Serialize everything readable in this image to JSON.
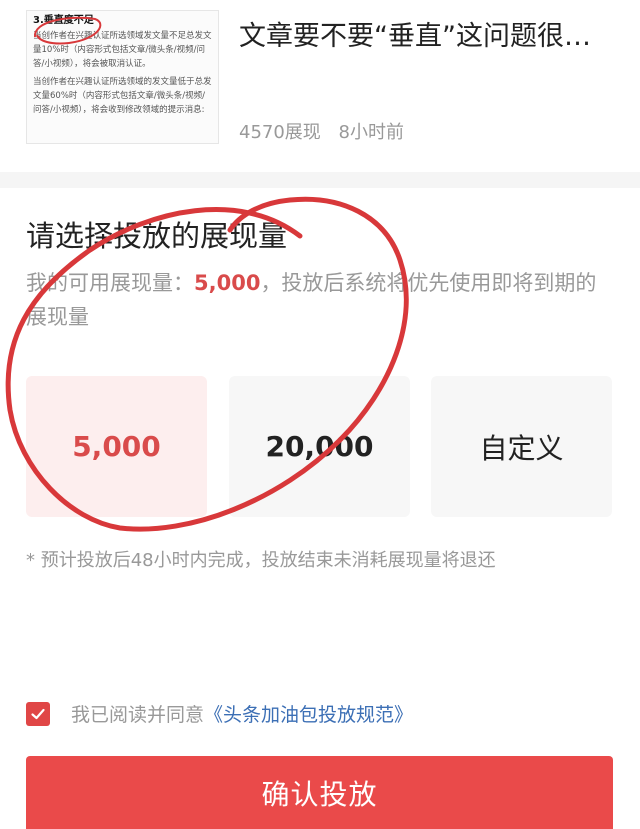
{
  "article": {
    "title": "文章要不要“垂直”这问题很…",
    "views": "4570展现",
    "time": "8小时前",
    "thumbnail": {
      "heading": "3.垂直度不足",
      "para1": "当创作者在兴趣认证所选领域发文量不足总发文量10%时（内容形式包括文章/微头条/视频/问答/小视频），将会被取消认证。",
      "para2": "当创作者在兴趣认证所选领域的发文量低于总发文量60%时（内容形式包括文章/微头条/视频/问答/小视频），将会收到修改领域的提示消息:"
    }
  },
  "select": {
    "title": "请选择投放的展现量",
    "desc_prefix": "我的可用展现量：",
    "available": "5,000",
    "desc_suffix": "，投放后系统将优先使用即将到期的展现量",
    "options": [
      {
        "label": "5,000",
        "selected": true
      },
      {
        "label": "20,000",
        "selected": false
      },
      {
        "label": "自定义",
        "selected": false
      }
    ],
    "note": "* 预计投放后48小时内完成，投放结束未消耗展现量将退还"
  },
  "agreement": {
    "text": "我已阅读并同意",
    "link": "《头条加油包投放规范》",
    "checked": true
  },
  "confirm_label": "确认投放",
  "colors": {
    "accent": "#ea4a4a",
    "highlight": "#d94b4b",
    "selected_bg": "#fdeeee",
    "link": "#3c6fb5",
    "annotation": "#d8383a"
  }
}
